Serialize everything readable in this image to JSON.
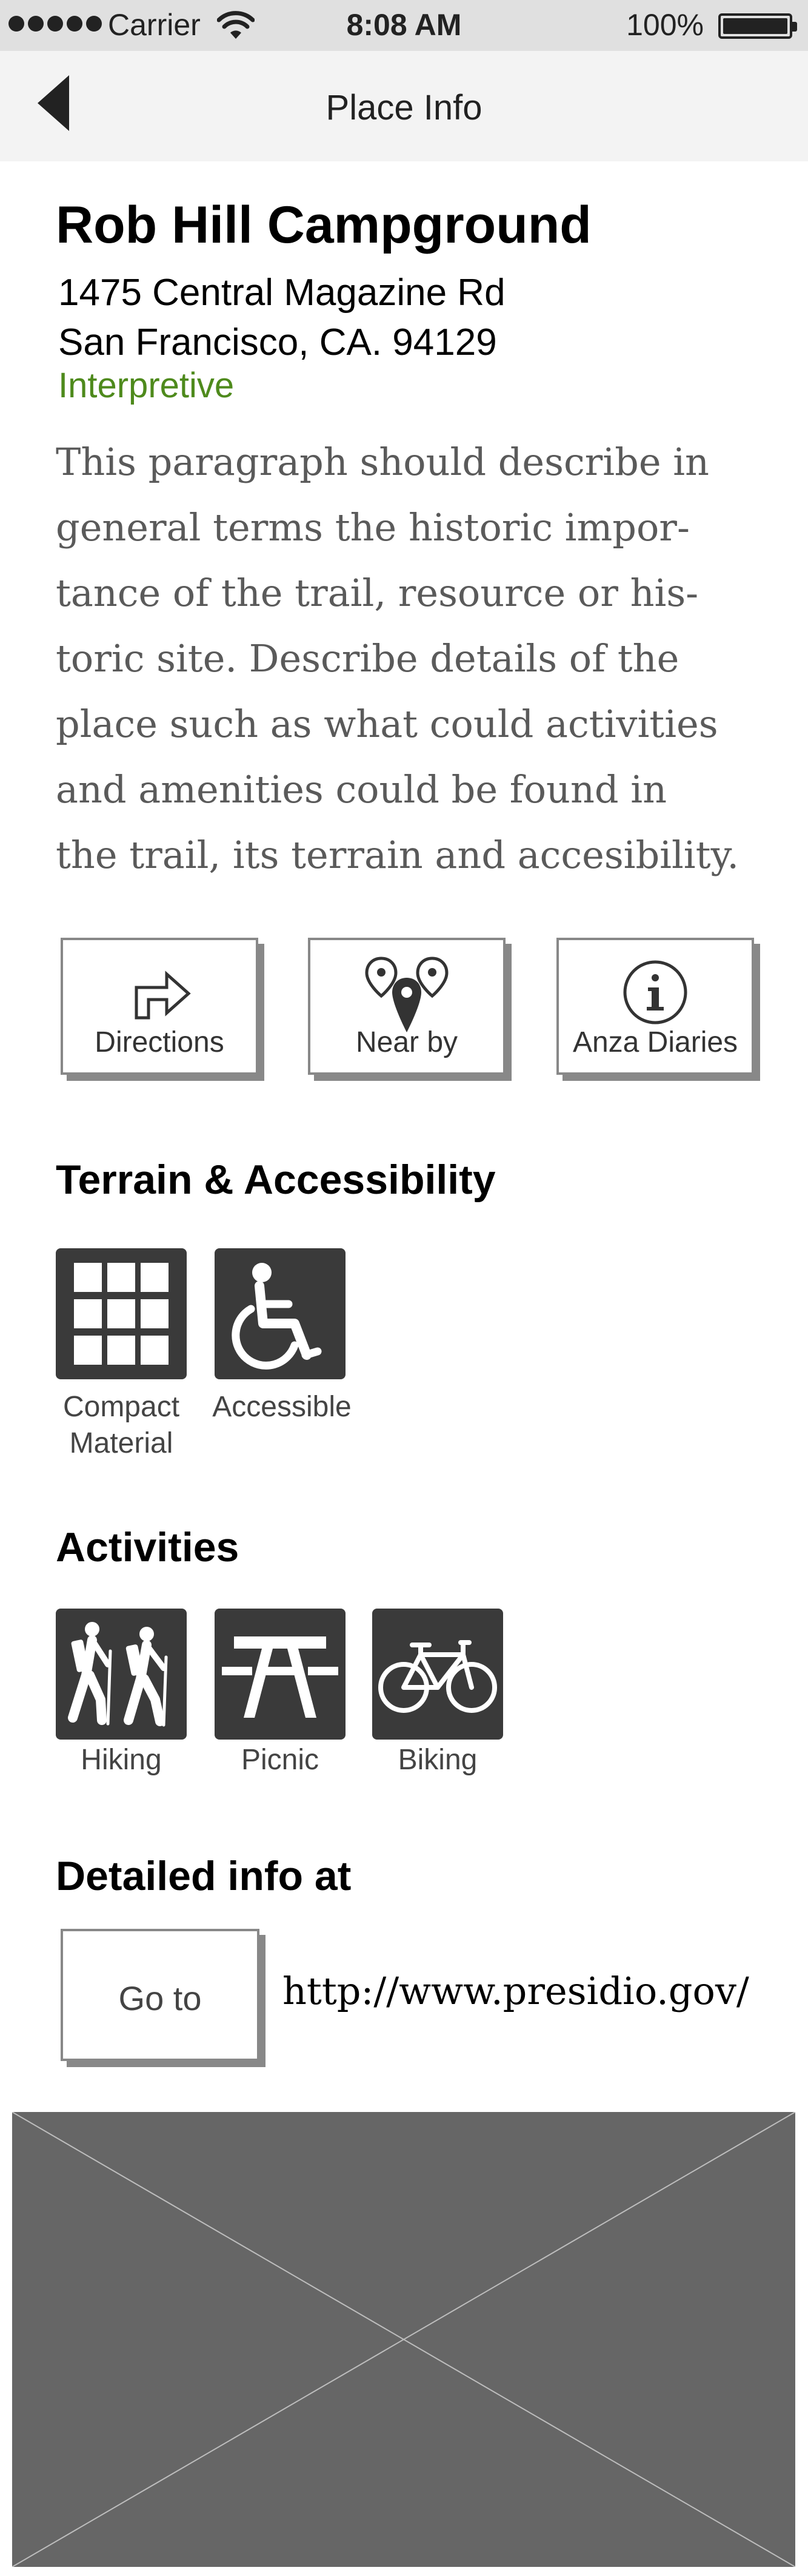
{
  "status_bar": {
    "carrier": "Carrier",
    "time": "8:08 AM",
    "battery": "100%"
  },
  "nav": {
    "title": "Place Info",
    "back_icon": "chevron-left-icon"
  },
  "place": {
    "name": "Rob Hill Campground",
    "address_line1": "1475 Central Magazine Rd",
    "address_line2": "San Francisco, CA. 94129",
    "category": "Interpretive",
    "category_color": "#4e8a1c",
    "description_lines": [
      "This paragraph should describe in",
      "general terms the historic impor-",
      "tance of the trail, resource or his-",
      "toric site. Describe details of the",
      "place such as what could activities",
      "and amenities could be found in",
      "the trail, its terrain and accesibility."
    ]
  },
  "actions": [
    {
      "label": "Directions",
      "icon": "directions-arrow-icon"
    },
    {
      "label": "Near by",
      "icon": "map-pins-icon"
    },
    {
      "label": "Anza Diaries",
      "icon": "info-icon"
    }
  ],
  "terrain": {
    "title": "Terrain & Accessibility",
    "items": [
      {
        "label_line1": "Compact",
        "label_line2": "Material",
        "icon": "grid-icon"
      },
      {
        "label_line1": "Accessible",
        "label_line2": "",
        "icon": "wheelchair-icon"
      }
    ]
  },
  "activities": {
    "title": "Activities",
    "items": [
      {
        "label": "Hiking",
        "icon": "hiking-icon"
      },
      {
        "label": "Picnic",
        "icon": "picnic-table-icon"
      },
      {
        "label": "Biking",
        "icon": "bicycle-icon"
      }
    ]
  },
  "detailed_info": {
    "title": "Detailed info at",
    "button_label": "Go to",
    "url": "http://www.presidio.gov/"
  }
}
